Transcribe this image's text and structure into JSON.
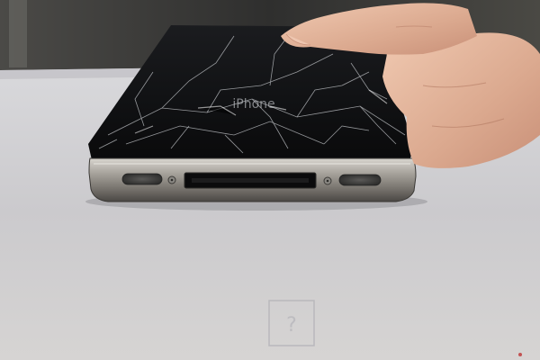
{
  "image": {
    "kind": "photograph",
    "description_hidden": true
  },
  "colors": {
    "wall_dark": "#3b3b39",
    "surface": "#d2d1d4",
    "surface_shadow": "#b9b8bc",
    "glass": "#111214",
    "steel_band": "#8e8b86",
    "skin": "#e0b49a"
  },
  "phone": {
    "logo_text": "iPhone"
  }
}
